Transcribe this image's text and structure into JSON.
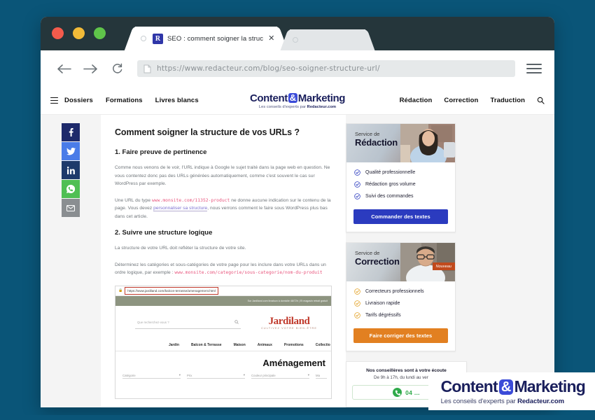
{
  "browser": {
    "tab": {
      "favicon_letter": "R",
      "title": "SEO : comment soigner la struc",
      "close_label": "✕"
    },
    "tab_inactive_label": "",
    "toolbar": {
      "back_icon": "arrow-left-icon",
      "forward_icon": "arrow-right-icon",
      "reload_icon": "reload-icon",
      "url": "https://www.redacteur.com/blog/seo-soigner-structure-url/",
      "menu_icon": "hamburger-menu-icon"
    }
  },
  "site_header": {
    "menu_icon": "hamburger-menu-icon",
    "left_links": [
      "Dossiers",
      "Formations",
      "Livres blancs"
    ],
    "logo": {
      "word1": "Content",
      "amp": "&",
      "word2": "Marketing",
      "tagline_prefix": "Les conseils d'experts par ",
      "tagline_brand": "Redacteur.com"
    },
    "right_links": [
      "Rédaction",
      "Correction",
      "Traduction"
    ],
    "search_icon": "search-icon"
  },
  "share": {
    "buttons": [
      {
        "name": "facebook",
        "glyph": "f"
      },
      {
        "name": "twitter",
        "glyph": "t"
      },
      {
        "name": "linkedin",
        "glyph": "in"
      },
      {
        "name": "whatsapp",
        "glyph": "w"
      },
      {
        "name": "email",
        "glyph": "✉"
      }
    ]
  },
  "article": {
    "h1": "Comment soigner la structure de vos URLs ?",
    "section1_title": "1. Faire preuve de pertinence",
    "p1": "Comme nous venons de le voir, l'URL indique à Google le sujet traité dans la page web en question. Ne vous contentez donc pas des URLs générées automatiquement, comme c'est souvent le cas sur WordPress par exemple.",
    "p2_a": "Une URL du type ",
    "p2_code": "www.monsite.com/11352-product",
    "p2_b": " ne donne aucune indication sur le contenu de la page. Vous devez ",
    "p2_link": "personnaliser sa structure",
    "p2_c": ", nous verrons comment le faire sous WordPress plus bas dans cet article.",
    "section2_title": "2. Suivre une structure logique",
    "p3": "La structure de votre URL doit refléter la structure de votre site.",
    "p4_a": "Déterminez les catégories et sous-catégories de votre page pour les inclure dans votre URLs dans un ordre logique, par exemple : ",
    "p4_code": "www.monsite.com/categorie/sous-categorie/nom-du-produit",
    "screenshot": {
      "url": "https://www.jardiland.com/balcon-terrasse/amenagement.html",
      "lock_icon": "lock-icon",
      "banner_text": "Sur Jardiland.com livraison à domicile 48/72h | Et magasin retrait gratuit",
      "search_placeholder": "Que recherchez-vous ?",
      "search_icon": "search-icon",
      "brand": "Jardiland",
      "brand_tagline": "CULTIVEZ VOTRE BIEN-ÊTRE",
      "nav": [
        "Jardin",
        "Balcon & Terrasse",
        "Maison",
        "Animaux",
        "Promotions",
        "Collectio"
      ],
      "page_title": "Aménagement",
      "filters": [
        "Catégorie",
        "Prix",
        "Couleur principale",
        "Ma"
      ]
    }
  },
  "sidebar": {
    "cards": [
      {
        "kicker": "Service de",
        "title": "Rédaction",
        "badge": null,
        "features": [
          "Qualité professionnelle",
          "Rédaction gros volume",
          "Suivi des commandes"
        ],
        "cta": "Commander des textes",
        "cta_color": "#2b3bbf",
        "check_color": "#2b3bbf"
      },
      {
        "kicker": "Service de",
        "title": "Correction",
        "badge": "Nouveau",
        "features": [
          "Correcteurs professionnels",
          "Livraison rapide",
          "Tarifs dégréssifs"
        ],
        "cta": "Faire corriger des textes",
        "cta_color": "#e28021",
        "check_color": "#e2a021"
      }
    ],
    "phone_card": {
      "line1": "Nos conseillères sont à votre écoute",
      "line2": "De 9h à 17h, du lundi au vendredi",
      "phone_icon": "phone-icon",
      "phone": "04 ..."
    }
  },
  "watermark": {
    "word1": "Content",
    "amp": "&",
    "word2": "Marketing",
    "tagline_prefix": "Les conseils d'experts par ",
    "tagline_brand": "Redacteur.com"
  },
  "colors": {
    "desktop_bg": "#0a5578",
    "titlebar": "#25363b",
    "brand_navy": "#1a1f5c",
    "brand_blue": "#3b4bd8",
    "orange": "#e28021"
  }
}
